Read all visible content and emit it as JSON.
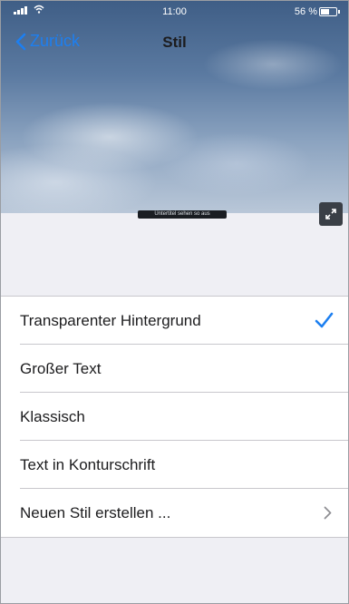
{
  "status_bar": {
    "time": "11:00",
    "battery": "56 %"
  },
  "nav": {
    "back_label": "Zurück",
    "title": "Stil"
  },
  "preview": {
    "caption": "Untertitel sehen so aus"
  },
  "style_options": [
    {
      "label": "Transparenter Hintergrund",
      "selected": true
    },
    {
      "label": "Großer Text",
      "selected": false
    },
    {
      "label": "Klassisch",
      "selected": false
    },
    {
      "label": "Text in Konturschrift",
      "selected": false
    },
    {
      "label": "Neuen Stil erstellen ...",
      "has_disclosure": true
    }
  ],
  "colors": {
    "accent": "#1d7ff0",
    "background": "#efeff4"
  }
}
